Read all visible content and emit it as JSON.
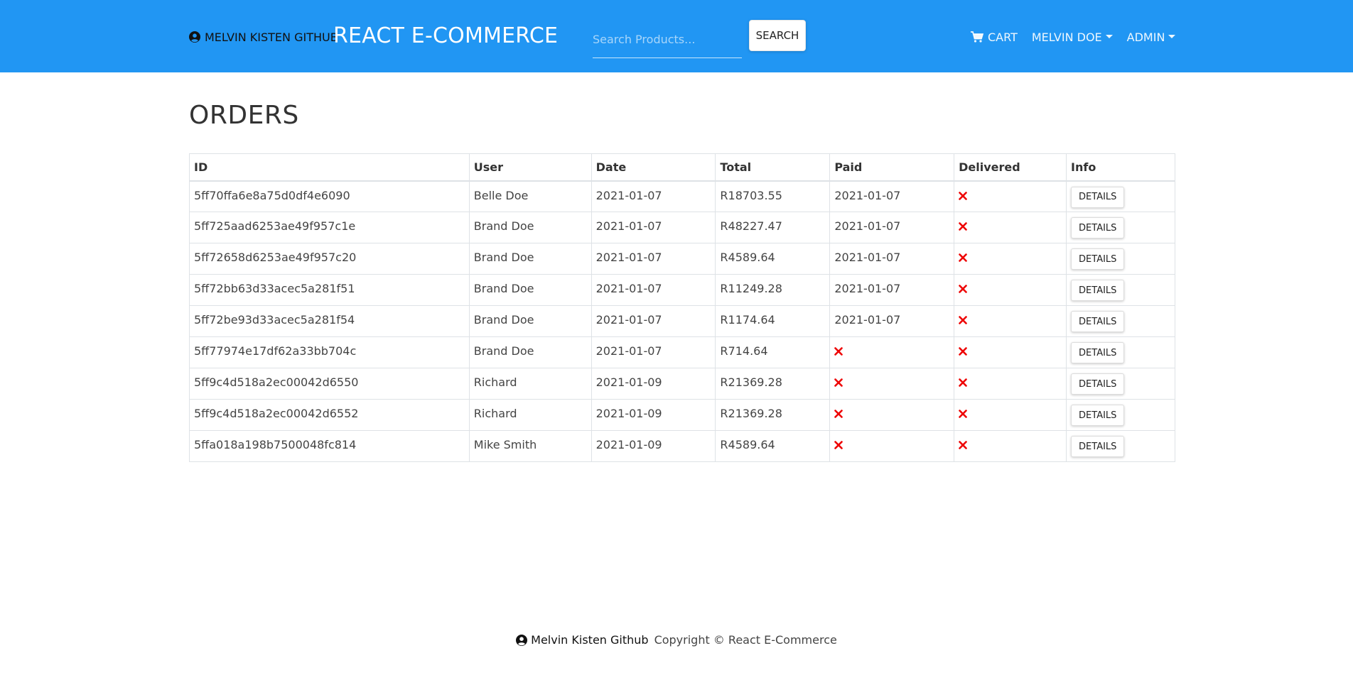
{
  "navbar": {
    "github_label": "MELVIN KISTEN GITHUB",
    "brand": "REACT E-COMMERCE",
    "search_placeholder": "Search Products...",
    "search_button": "SEARCH",
    "cart_label": "CART",
    "user_menu": "MELVIN DOE",
    "admin_menu": "ADMIN",
    "bg_color": "#2196f3"
  },
  "page": {
    "title": "ORDERS"
  },
  "table": {
    "headers": [
      "ID",
      "User",
      "Date",
      "Total",
      "Paid",
      "Delivered",
      "Info"
    ],
    "details_label": "DETAILS",
    "rows": [
      {
        "id": "5ff70ffa6e8a75d0df4e6090",
        "user": "Belle Doe",
        "date": "2021-01-07",
        "total": "R18703.55",
        "paid": "2021-01-07",
        "delivered": null
      },
      {
        "id": "5ff725aad6253ae49f957c1e",
        "user": "Brand Doe",
        "date": "2021-01-07",
        "total": "R48227.47",
        "paid": "2021-01-07",
        "delivered": null
      },
      {
        "id": "5ff72658d6253ae49f957c20",
        "user": "Brand Doe",
        "date": "2021-01-07",
        "total": "R4589.64",
        "paid": "2021-01-07",
        "delivered": null
      },
      {
        "id": "5ff72bb63d33acec5a281f51",
        "user": "Brand Doe",
        "date": "2021-01-07",
        "total": "R11249.28",
        "paid": "2021-01-07",
        "delivered": null
      },
      {
        "id": "5ff72be93d33acec5a281f54",
        "user": "Brand Doe",
        "date": "2021-01-07",
        "total": "R1174.64",
        "paid": "2021-01-07",
        "delivered": null
      },
      {
        "id": "5ff77974e17df62a33bb704c",
        "user": "Brand Doe",
        "date": "2021-01-07",
        "total": "R714.64",
        "paid": null,
        "delivered": null
      },
      {
        "id": "5ff9c4d518a2ec00042d6550",
        "user": "Richard",
        "date": "2021-01-09",
        "total": "R21369.28",
        "paid": null,
        "delivered": null
      },
      {
        "id": "5ff9c4d518a2ec00042d6552",
        "user": "Richard",
        "date": "2021-01-09",
        "total": "R21369.28",
        "paid": null,
        "delivered": null
      },
      {
        "id": "5ffa018a198b7500048fc814",
        "user": "Mike Smith",
        "date": "2021-01-09",
        "total": "R4589.64",
        "paid": null,
        "delivered": null
      }
    ],
    "unpaid_icon": "x-icon",
    "x_color": "#ee0000"
  },
  "footer": {
    "github_label": "Melvin Kisten Github",
    "copyright": "Copyright © React E-Commerce"
  }
}
